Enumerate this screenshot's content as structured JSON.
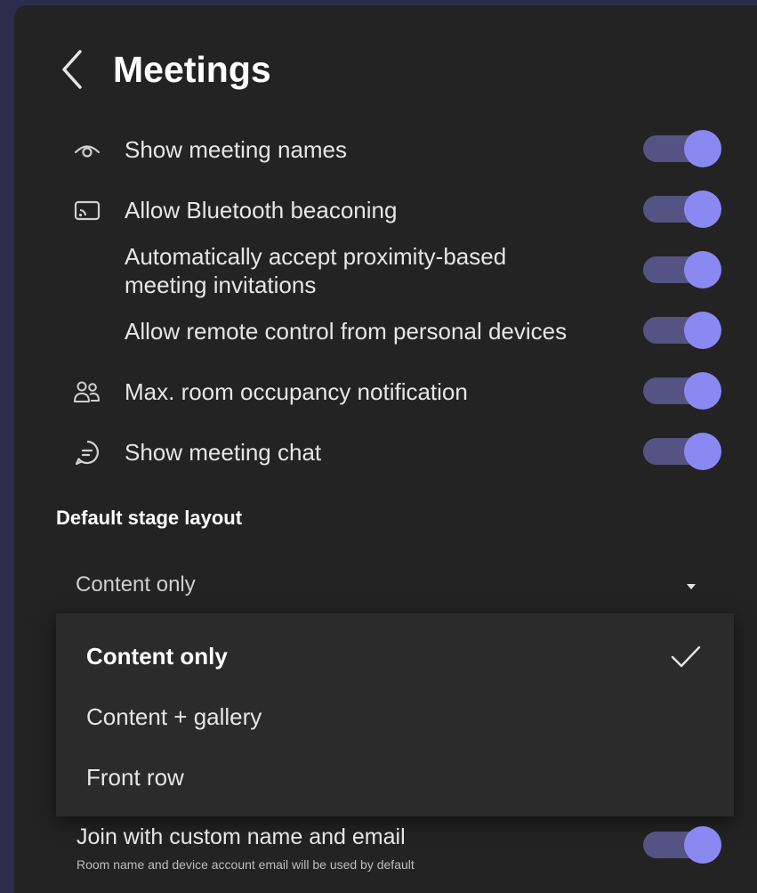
{
  "header": {
    "title": "Meetings",
    "back_icon": "chevron-left-icon"
  },
  "settings": [
    {
      "label": "Show meeting names",
      "icon": "eye-icon",
      "enabled": true
    },
    {
      "label": "Allow Bluetooth beaconing",
      "icon": "cast-icon",
      "enabled": true
    },
    {
      "label_line1": "Automatically accept proximity-based",
      "label_line2": "meeting invitations",
      "icon": "",
      "enabled": true
    },
    {
      "label": "Allow remote control from personal devices",
      "icon": "",
      "enabled": true
    },
    {
      "label": "Max. room occupancy notification",
      "icon": "people-icon",
      "enabled": true
    },
    {
      "label": "Show meeting chat",
      "icon": "chat-icon",
      "enabled": true
    }
  ],
  "stage_layout": {
    "heading": "Default stage layout",
    "selected_value": "Content only",
    "options": [
      {
        "label": "Content only",
        "selected": true
      },
      {
        "label": "Content + gallery",
        "selected": false
      },
      {
        "label": "Front row",
        "selected": false
      }
    ]
  },
  "custom_join": {
    "label": "Join with custom name and email",
    "sub_label": "Room name and device account email will be used by default",
    "enabled": true
  },
  "colors": {
    "toggle_track": "#545383",
    "toggle_knob": "#8a89f2",
    "panel_bg": "#232323",
    "outer_bg": "#2d2b4e"
  }
}
